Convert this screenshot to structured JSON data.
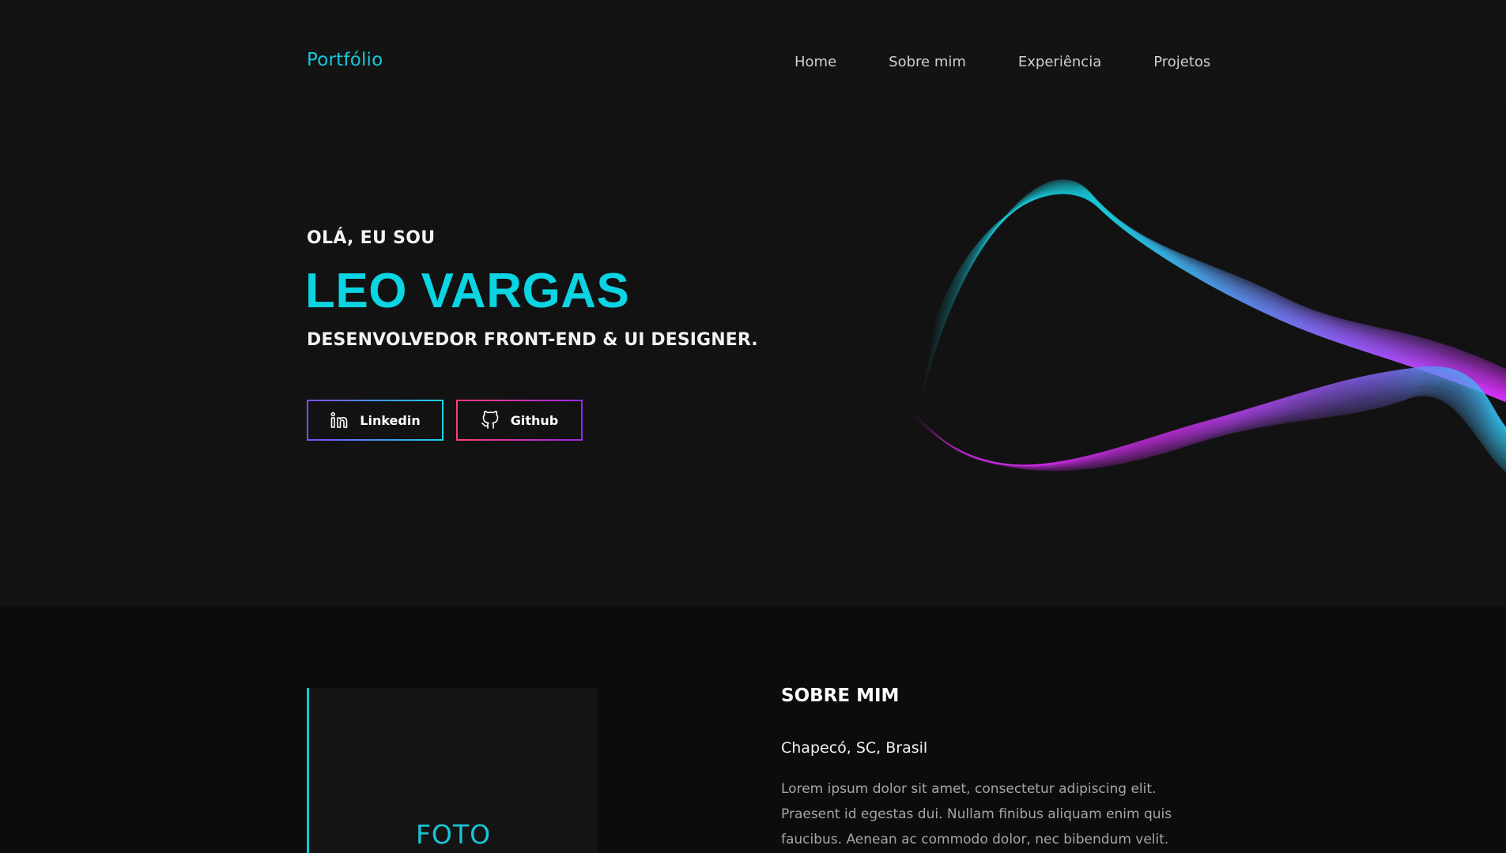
{
  "nav": {
    "logo": "Portfólio",
    "links": [
      "Home",
      "Sobre mim",
      "Experiência",
      "Projetos"
    ]
  },
  "hero": {
    "greeting": "OLÁ, EU SOU",
    "name": "LEO VARGAS",
    "role": "DESENVOLVEDOR FRONT-END & UI DESIGNER.",
    "buttons": {
      "linkedin": "Linkedin",
      "github": "Github"
    }
  },
  "about": {
    "photo_label": "FOTO",
    "title": "SOBRE MIM",
    "location": "Chapecó, SC, Brasil",
    "text": "Lorem ipsum dolor sit amet, consectetur adipiscing elit. Praesent id egestas dui. Nullam finibus aliquam enim quis faucibus. Aenean ac commodo dolor, nec bibendum velit."
  },
  "icons": {
    "linkedin": "linkedin-icon",
    "github": "github-icon"
  },
  "colors": {
    "accent": "#0bd4e3",
    "background": "#121212",
    "section_dark": "#0c0c0c",
    "magenta": "#e32bff"
  }
}
